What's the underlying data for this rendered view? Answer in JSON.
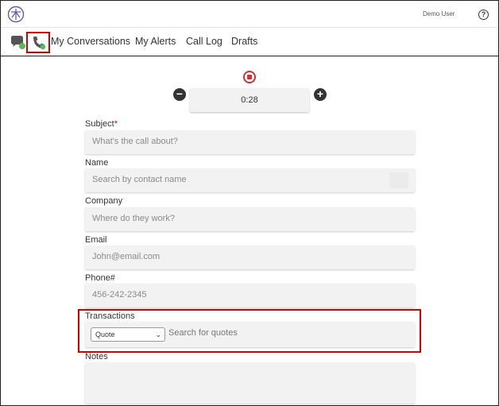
{
  "header": {
    "logo_icon": "logo-icon",
    "user_name": "Demo User",
    "help_icon": "help-icon",
    "help_glyph": "?"
  },
  "nav": {
    "chat_icon": "chat-bubbles-icon",
    "phone_icon": "phone-icon",
    "links": [
      "My Conversations",
      "My Alerts",
      "Call Log",
      "Drafts"
    ]
  },
  "timer": {
    "value": "0:28",
    "minus_glyph": "−",
    "plus_glyph": "+"
  },
  "form": {
    "subject": {
      "label": "Subject",
      "required_mark": "*",
      "placeholder": "What's the call about?"
    },
    "name": {
      "label": "Name",
      "placeholder": "Search by contact name"
    },
    "company": {
      "label": "Company",
      "placeholder": "Where do they work?"
    },
    "email": {
      "label": "Email",
      "placeholder": "John@email.com"
    },
    "phone": {
      "label": "Phone#",
      "placeholder": "456-242-2345"
    },
    "transactions": {
      "label": "Transactions",
      "type_selected": "Quote",
      "search_placeholder": "Search for quotes"
    },
    "notes": {
      "label": "Notes"
    }
  },
  "colors": {
    "highlight": "#d40000",
    "accent_green": "#5cb85c",
    "record": "#d43030",
    "logo": "#6b5ba3"
  }
}
